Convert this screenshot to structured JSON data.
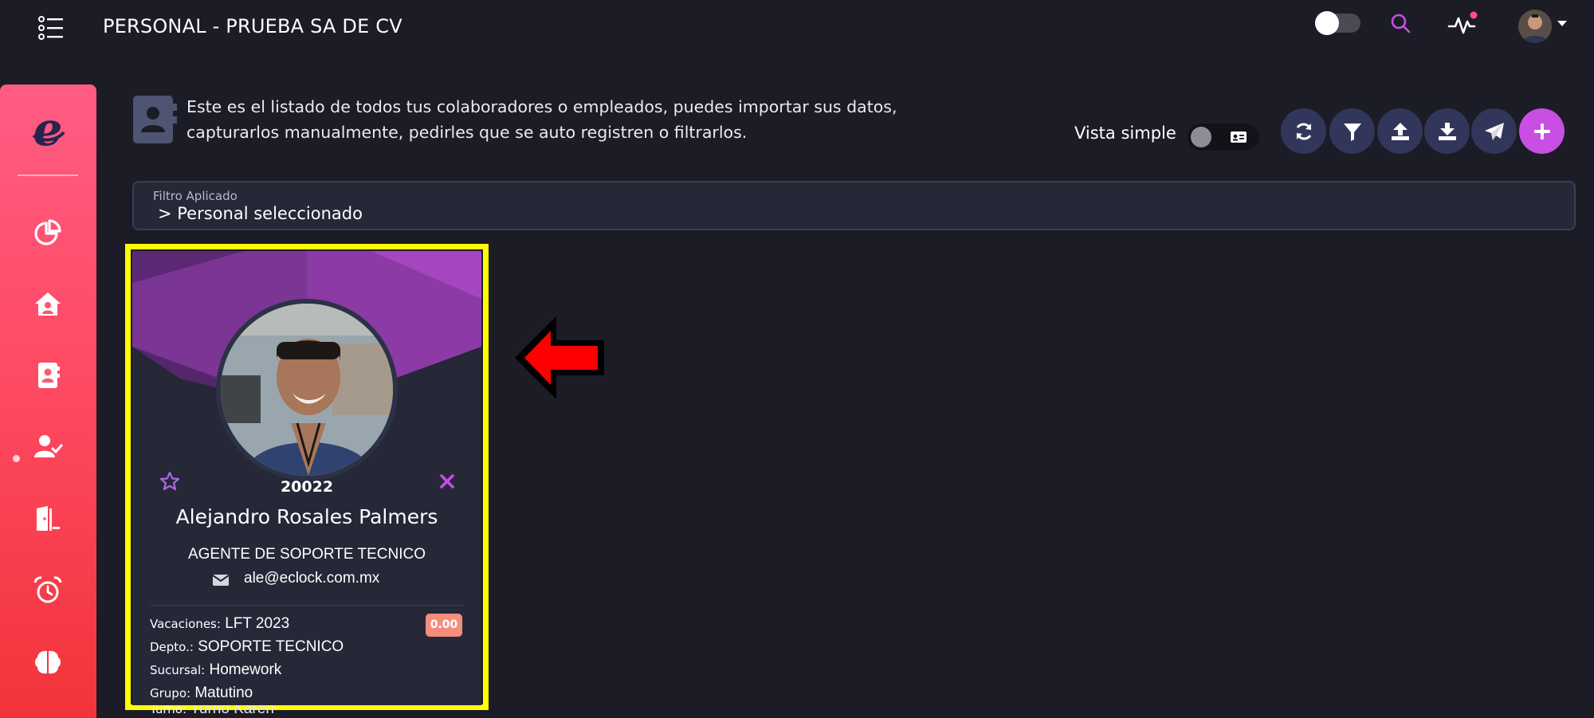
{
  "header": {
    "title": "PERSONAL - PRUEBA SA DE CV"
  },
  "sidebar": {
    "logo_icon": "eclock-logo",
    "items": [
      {
        "icon": "pie-chart-icon"
      },
      {
        "icon": "home-icon"
      },
      {
        "icon": "contacts-book-icon",
        "active": true
      },
      {
        "icon": "user-check-icon"
      },
      {
        "icon": "door-exit-icon"
      },
      {
        "icon": "alarm-clock-icon"
      },
      {
        "icon": "brain-icon"
      }
    ]
  },
  "intro": {
    "line1": "Este es el listado de todos tus colaboradores o empleados, puedes importar sus datos,",
    "line2": "capturarlos manualmente, pedirles que se auto registren o filtrarlos."
  },
  "view_toggle": {
    "label": "Vista simple",
    "on": false
  },
  "actions": [
    {
      "icon": "refresh-icon"
    },
    {
      "icon": "filter-icon"
    },
    {
      "icon": "upload-icon"
    },
    {
      "icon": "download-icon"
    },
    {
      "icon": "send-icon"
    },
    {
      "icon": "plus-icon"
    }
  ],
  "filter": {
    "caption": "Filtro Aplicado",
    "value": "> Personal seleccionado"
  },
  "employee": {
    "number": "20022",
    "name": "Alejandro Rosales Palmers",
    "role": "AGENTE DE SOPORTE TECNICO",
    "email": "ale@eclock.com.mx",
    "vacation_badge": "0.00",
    "fields": {
      "vacaciones_label": "Vacaciones:",
      "vacaciones_value": "LFT 2023",
      "depto_label": "Depto.:",
      "depto_value": "SOPORTE TECNICO",
      "sucursal_label": "Sucursal:",
      "sucursal_value": "Homework",
      "grupo_label": "Grupo:",
      "grupo_value": "Matutino",
      "turno_label": "Turno:",
      "turno_value": "Turno Karen"
    }
  },
  "colors": {
    "background": "#1c1c27",
    "sidebar_top": "#ff5c84",
    "sidebar_bottom": "#f2343a",
    "accent_purple": "#c94ee3",
    "action_button": "#32365a",
    "highlight_outline": "#ffff00",
    "pointer_arrow": "#ff0000",
    "badge": "#f48e7c"
  }
}
